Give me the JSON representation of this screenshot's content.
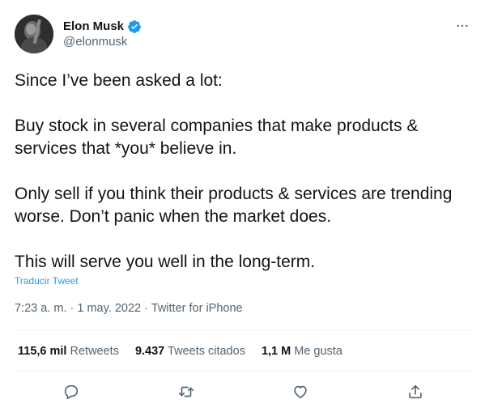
{
  "author": {
    "display_name": "Elon Musk",
    "handle": "@elonmusk",
    "verified": true,
    "verified_color": "#1d9bf0"
  },
  "tweet": {
    "paragraphs": [
      "Since I’ve been asked a lot:",
      "Buy stock in several companies that make products & services that *you* believe in.",
      "Only sell if you think their products & services are trending worse. Don’t panic when the market does.",
      "This will serve you well in the long-term."
    ],
    "translate_label": "Traducir Tweet"
  },
  "meta": {
    "time": "7:23 a. m.",
    "date": "1 may. 2022",
    "source": "Twitter for iPhone",
    "separator": "·"
  },
  "stats": {
    "retweets_count": "115,6 mil",
    "retweets_label": "Retweets",
    "quotes_count": "9.437",
    "quotes_label": "Tweets citados",
    "likes_count": "1,1 M",
    "likes_label": "Me gusta"
  },
  "icons": {
    "more": "more-horizontal-icon",
    "reply": "reply-icon",
    "retweet": "retweet-icon",
    "like": "heart-icon",
    "share": "share-icon"
  },
  "colors": {
    "text_primary": "#0f1419",
    "text_secondary": "#536471",
    "accent": "#1d9bf0",
    "divider": "#eff3f4"
  }
}
